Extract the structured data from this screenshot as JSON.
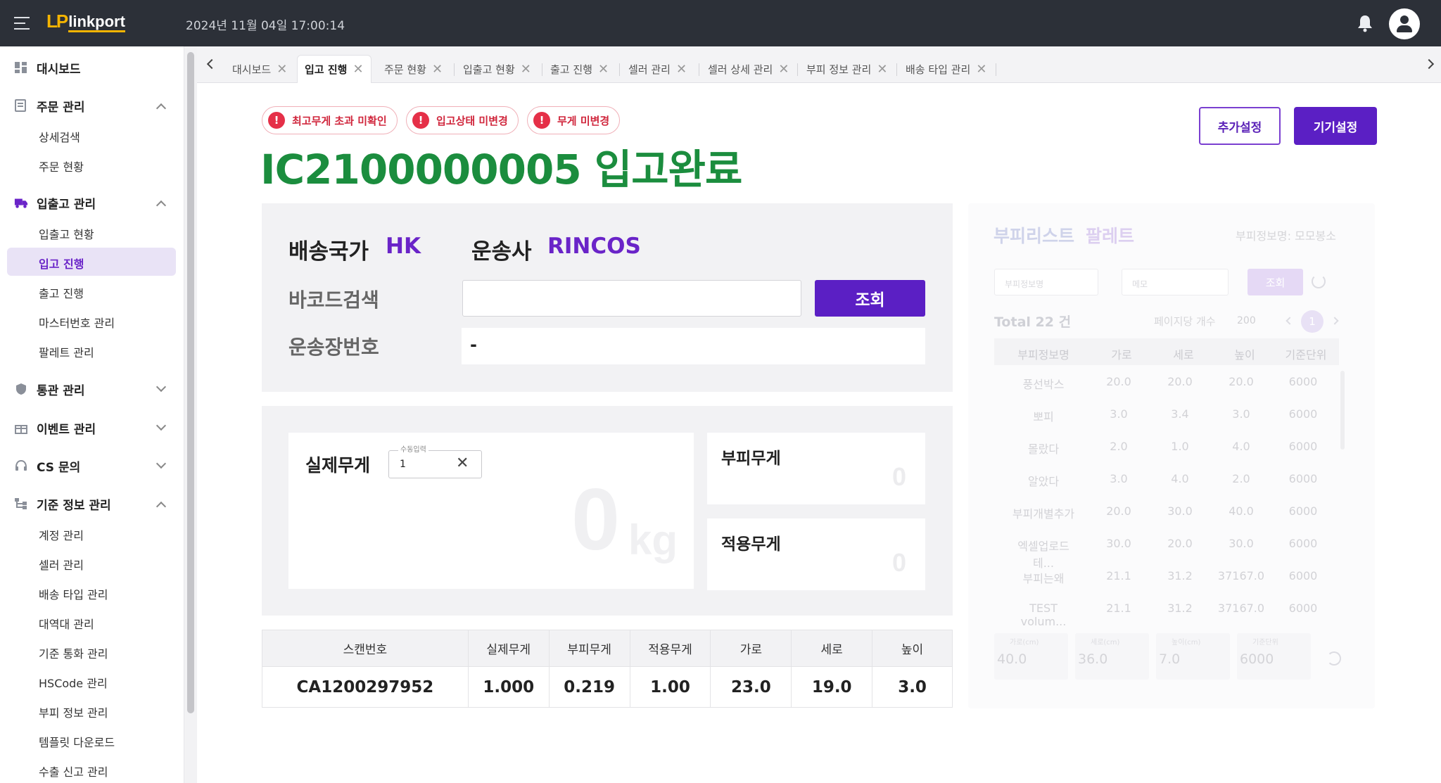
{
  "header": {
    "logo_mark": "LP",
    "logo_text": "linkport",
    "datetime": "2024년 11월 04일 17:00:14"
  },
  "sidebar": {
    "dashboard": "대시보드",
    "order_mgmt": "주문 관리",
    "order_items": [
      "상세검색",
      "주문 현황"
    ],
    "io_mgmt": "입출고 관리",
    "io_items": [
      "입출고 현황",
      "입고 진행",
      "출고 진행",
      "마스터번호 관리",
      "팔레트 관리"
    ],
    "customs_mgmt": "통관 관리",
    "event_mgmt": "이벤트 관리",
    "cs": "CS 문의",
    "base_mgmt": "기준 정보 관리",
    "base_items": [
      "계정 관리",
      "셀러 관리",
      "배송 타입 관리",
      "대역대 관리",
      "기준 통화 관리",
      "HSCode 관리",
      "부피 정보 관리",
      "템플릿 다운로드",
      "수출 신고 관리"
    ]
  },
  "tabs": [
    "대시보드",
    "입고 진행",
    "주문 현황",
    "입출고 현황",
    "출고 진행",
    "셀러 관리",
    "셀러 상세 관리",
    "부피 정보 관리",
    "배송 타입 관리"
  ],
  "alerts": [
    "최고무게 초과 미확인",
    "입고상태 미변경",
    "무게 미변경"
  ],
  "alert_icon": "!",
  "title": "IC2100000005 입고완료",
  "buttons": {
    "extra_settings": "추가설정",
    "device_settings": "기기설정",
    "search": "조회"
  },
  "shipping": {
    "country_label": "배송국가",
    "country_value": "HK",
    "carrier_label": "운송사",
    "carrier_value": "RINCOS",
    "barcode_label": "바코드검색",
    "waybill_label": "운송장번호",
    "waybill_value": "-"
  },
  "weight": {
    "actual_label": "실제무게",
    "manual_legend": "수동입력",
    "manual_value": "1",
    "actual_display": "0",
    "unit": "kg",
    "volume_label": "부피무게",
    "volume_value": "0",
    "applied_label": "적용무게",
    "applied_value": "0"
  },
  "scan_table": {
    "headers": [
      "스캔번호",
      "실제무게",
      "부피무게",
      "적용무게",
      "가로",
      "세로",
      "높이"
    ],
    "row": [
      "CA1200297952",
      "1.000",
      "0.219",
      "1.00",
      "23.0",
      "19.0",
      "3.0"
    ]
  },
  "volume_panel": {
    "title_a": "부피리스트",
    "title_b": "팔레트",
    "info": "부피정보명: 모모봉소",
    "name_placeholder": "부피정보명",
    "memo_placeholder": "메모",
    "search": "조회",
    "total": "Total 22 건",
    "per_page_label": "페이지당 개수",
    "per_page": "200",
    "page": "1",
    "headers": [
      "부피정보명",
      "가로",
      "세로",
      "높이",
      "기준단위"
    ],
    "rows": [
      [
        "풍선박스",
        "20.0",
        "20.0",
        "20.0",
        "6000"
      ],
      [
        "뽀피",
        "3.0",
        "3.4",
        "3.0",
        "6000"
      ],
      [
        "몰랐다",
        "2.0",
        "1.0",
        "4.0",
        "6000"
      ],
      [
        "알았다",
        "3.0",
        "4.0",
        "2.0",
        "6000"
      ],
      [
        "부피개별추가",
        "20.0",
        "30.0",
        "40.0",
        "6000"
      ],
      [
        "엑셀업로드테...",
        "30.0",
        "20.0",
        "30.0",
        "6000"
      ],
      [
        "부피는왜",
        "21.1",
        "31.2",
        "37167.0",
        "6000"
      ],
      [
        "TEST volum...",
        "21.1",
        "31.2",
        "37167.0",
        "6000"
      ]
    ],
    "bottom_labels": [
      "가로(cm)",
      "세로(cm)",
      "높이(cm)",
      "기준단위"
    ],
    "bottom_values": [
      "40.0",
      "36.0",
      "7.0",
      "6000"
    ]
  }
}
